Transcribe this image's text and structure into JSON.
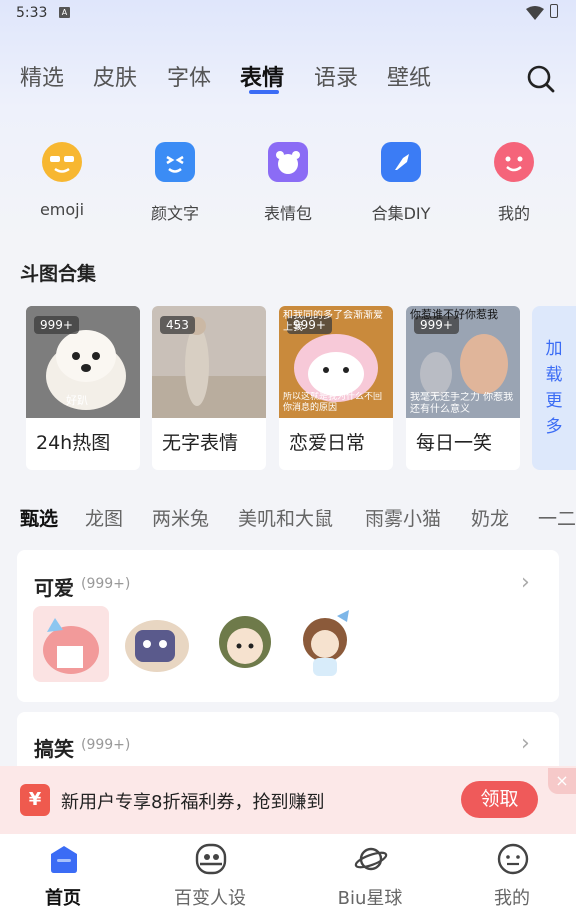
{
  "status_bar": {
    "time": "5:33",
    "notification_icon": "A"
  },
  "category_tabs": [
    "精选",
    "皮肤",
    "字体",
    "表情",
    "语录",
    "壁纸"
  ],
  "active_category": "表情",
  "quick_entries": [
    {
      "label": "emoji",
      "icon": "sunglasses-emoji-icon",
      "color": "#f7b731"
    },
    {
      "label": "颜文字",
      "icon": "kaomoji-icon",
      "color": "#3b8cf5"
    },
    {
      "label": "表情包",
      "icon": "bear-sticker-icon",
      "color": "#8b6cf5"
    },
    {
      "label": "合集DIY",
      "icon": "diy-pin-icon",
      "color": "#3b7cf5"
    },
    {
      "label": "我的",
      "icon": "smile-face-icon",
      "color": "#f5647a"
    }
  ],
  "collection": {
    "title": "斗图合集",
    "cards": [
      {
        "name": "24h热图",
        "badge": "999+",
        "caption": "好趴"
      },
      {
        "name": "无字表情",
        "badge": "453"
      },
      {
        "name": "恋爱日常",
        "badge": "999+",
        "caption_top": "和我同的多了会渐渐爱上我",
        "caption_bottom": "所以这就是我为什么不回你消息的原因"
      },
      {
        "name": "每日一笑",
        "badge": "999+",
        "caption_top": "你惹谁不好你惹我",
        "caption_bottom": "我毫无还手之力 你惹我还有什么意义"
      }
    ],
    "more_label": "加载更多"
  },
  "sub_tabs": [
    "甄选",
    "龙图",
    "两米兔",
    "美叽和大鼠",
    "雨雾小猫",
    "奶龙",
    "一二"
  ],
  "active_sub_tab": "甄选",
  "panels": [
    {
      "title": "可爱",
      "count": "(999+)"
    },
    {
      "title": "搞笑",
      "count": "(999+)"
    }
  ],
  "promo": {
    "text": "新用户专享8折福利券，抢到赚到",
    "button": "领取",
    "close": "×",
    "gift_glyph": "¥"
  },
  "bottom_nav": [
    {
      "label": "首页",
      "icon": "home-icon"
    },
    {
      "label": "百变人设",
      "icon": "persona-icon"
    },
    {
      "label": "Biu星球",
      "icon": "planet-icon"
    },
    {
      "label": "我的",
      "icon": "profile-face-icon"
    }
  ],
  "colors": {
    "accent": "#3b6cf5",
    "promo_red": "#ef5a5a"
  }
}
